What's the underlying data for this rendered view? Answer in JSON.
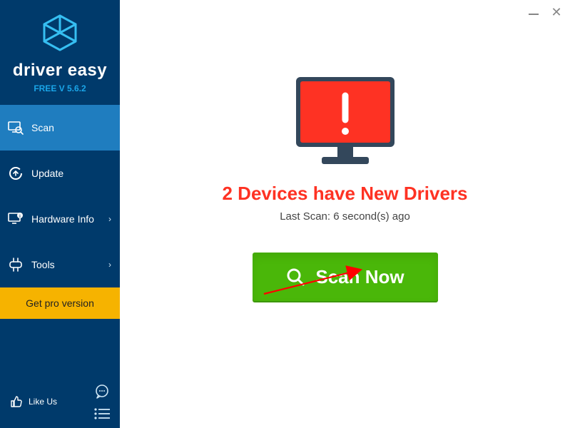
{
  "brand": {
    "name": "driver easy",
    "version": "FREE V 5.6.2"
  },
  "sidebar": {
    "items": [
      {
        "label": "Scan"
      },
      {
        "label": "Update"
      },
      {
        "label": "Hardware Info"
      },
      {
        "label": "Tools"
      }
    ],
    "pro_button": "Get pro version",
    "like_label": "Like Us"
  },
  "main": {
    "headline": "2 Devices have New Drivers",
    "subline": "Last Scan: 6 second(s) ago",
    "scan_button": "Scan Now"
  }
}
